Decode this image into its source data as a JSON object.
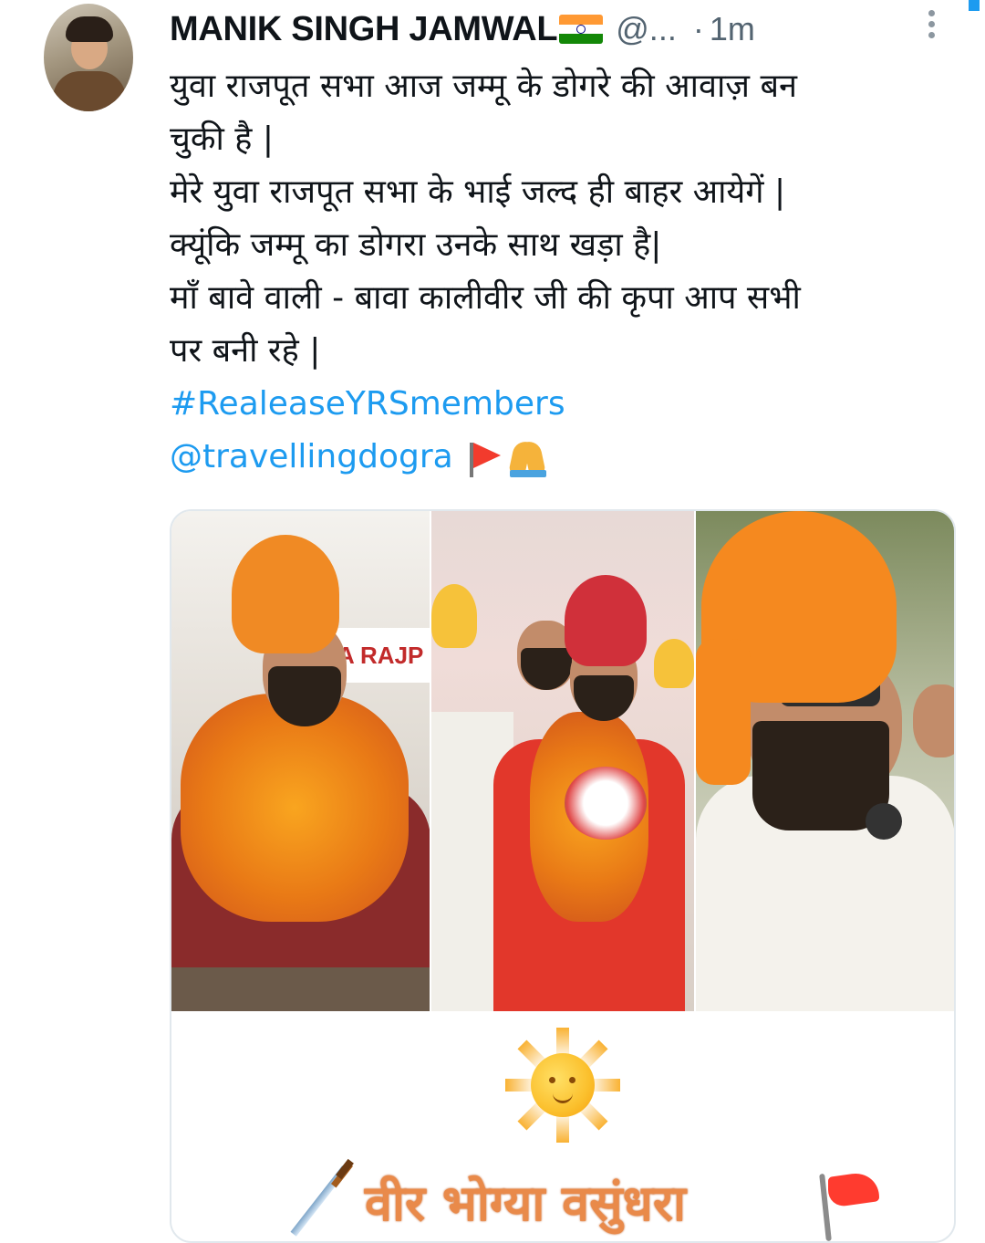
{
  "tweet": {
    "author_name": "MANIK SINGH JAMWAL",
    "handle": "@...",
    "separator": "·",
    "time": "1m",
    "flag_icon": "india-flag-icon",
    "lines": [
      "युवा राजपूत सभा आज जम्मू के डोगरे की आवाज़ बन",
      "चुकी है |",
      "मेरे युवा राजपूत सभा के भाई जल्द ही बाहर आयेगें |",
      "क्यूंकि जम्मू का डोगरा उनके साथ खड़ा है|",
      "माँ बावे वाली - बावा कालीवीर जी की कृपा आप सभी",
      "पर बनी रहे |"
    ],
    "hashtag": "#RealeaseYRSmembers",
    "mention": "@travellingdogra",
    "trailing_emojis": [
      "red-flag-icon",
      "folded-hands-icon"
    ]
  },
  "media": {
    "photo_banner_text": "A RAJP",
    "sticker_text": "वीर भोग्या वसुंधरा",
    "sticker_icons": [
      "sun-face-icon",
      "sword-icon",
      "red-flag-icon"
    ]
  },
  "colors": {
    "link": "#1d9bf0",
    "secondary_text": "#536471",
    "saffron": "#f08a24",
    "slogan": "#e98a4a"
  }
}
